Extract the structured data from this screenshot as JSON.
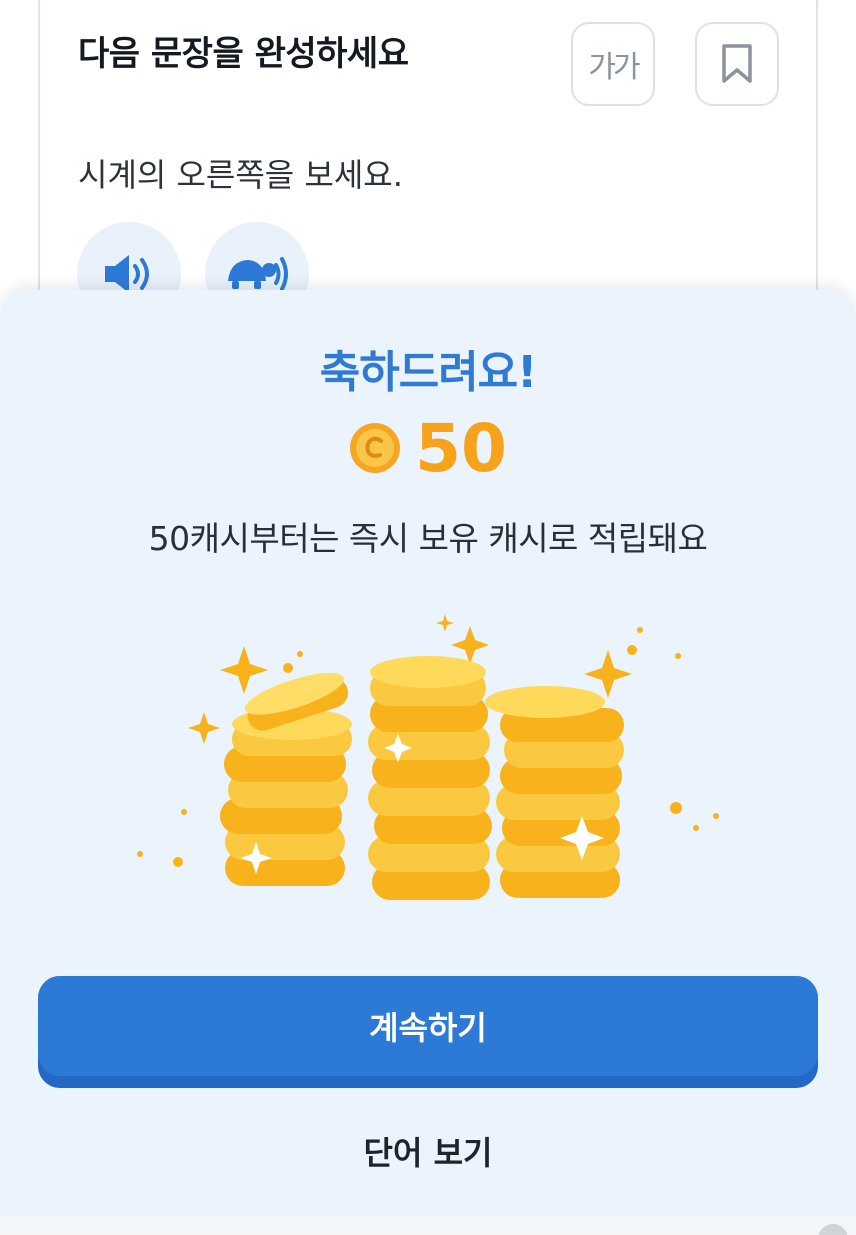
{
  "question": {
    "title": "다음 문장을 완성하세요",
    "font_size_label": "가가",
    "sentence": "시계의 오른쪽을 보세요."
  },
  "modal": {
    "title": "축하드려요!",
    "reward_amount": "50",
    "reward_note": "50캐시부터는 즉시 보유 캐시로 적립돼요",
    "continue_label": "계속하기",
    "view_words_label": "단어 보기"
  },
  "icons": {
    "font_size": "font-size-icon",
    "bookmark": "bookmark-icon",
    "audio_normal": "speaker-icon",
    "audio_slow": "turtle-speaker-icon",
    "coin": "coin-icon"
  },
  "colors": {
    "accent_blue": "#2d7ad6",
    "coin_orange": "#f7a21b",
    "sheet_background": "#ebf3fd"
  }
}
